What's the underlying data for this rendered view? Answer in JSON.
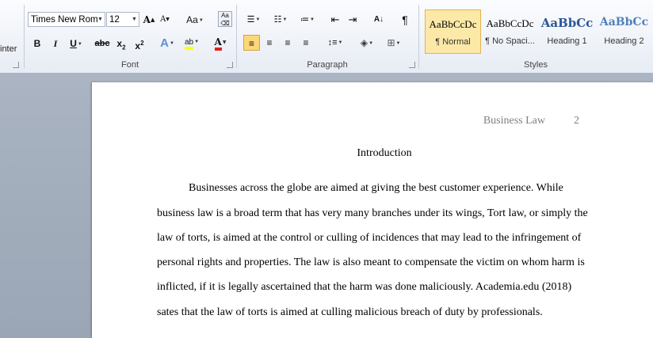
{
  "ribbon": {
    "clipboard": {
      "format_painter_partial": "inter"
    },
    "font": {
      "label": "Font",
      "font_name": "Times New Rom",
      "font_size": "12"
    },
    "paragraph": {
      "label": "Paragraph"
    },
    "styles": {
      "label": "Styles",
      "items": [
        {
          "sample": "AaBbCcDc",
          "name": "¶ Normal"
        },
        {
          "sample": "AaBbCcDc",
          "name": "¶ No Spaci..."
        },
        {
          "sample": "AaBbCс",
          "name": "Heading 1"
        },
        {
          "sample": "AaBbCc",
          "name": "Heading 2"
        }
      ]
    }
  },
  "document": {
    "header_text": "Business Law",
    "page_number": "2",
    "title": "Introduction",
    "lines": [
      "Businesses across the globe are aimed at giving the best customer experience. While",
      "business law is a broad term that has very many branches under its wings, Tort law, or simply the",
      "law of torts, is aimed at the control or culling of incidences that may lead to the infringement of",
      "personal rights and properties. The law is also meant to compensate the victim on whom harm is",
      "inflicted, if it is legally ascertained that the harm was done maliciously.  Academia.edu (2018)",
      "sates that the law of torts is aimed at culling malicious breach of duty by professionals."
    ]
  }
}
